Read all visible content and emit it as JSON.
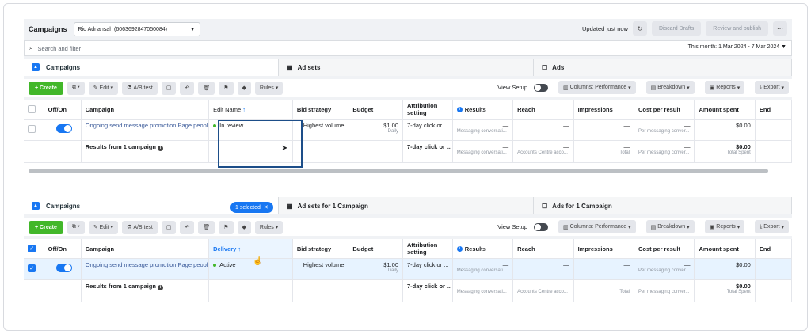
{
  "panel1": {
    "title": "Campaigns",
    "account": "Rio Adriansah (6063692847050084)",
    "updated": "Updated just now",
    "discard": "Discard Drafts",
    "review": "Review and publish",
    "search_placeholder": "Search and filter",
    "date_range": "This month: 1 Mar 2024 - 7 Mar 2024",
    "tabs": {
      "campaigns": "Campaigns",
      "adsets": "Ad sets",
      "ads": "Ads"
    },
    "toolbar": {
      "create": "Create",
      "edit": "Edit",
      "abtest": "A/B test",
      "rules": "Rules",
      "view_setup": "View Setup",
      "columns": "Columns: Performance",
      "breakdown": "Breakdown",
      "reports": "Reports",
      "export": "Export"
    },
    "headers": {
      "offon": "Off/On",
      "campaign": "Campaign",
      "delivery": "Edit Name",
      "bid": "Bid strategy",
      "budget": "Budget",
      "attribution": "Attribution setting",
      "results": "Results",
      "reach": "Reach",
      "impressions": "Impressions",
      "cpr": "Cost per result",
      "spent": "Amount spent",
      "end": "End"
    },
    "row": {
      "campaign": "Ongoing send message promotion Page people",
      "delivery": "In review",
      "bid": "Highest volume",
      "budget": "$1.00",
      "budget_sub": "Daily",
      "attribution": "7-day click or ...",
      "results": "—",
      "results_sub": "Messaging conversati...",
      "reach": "—",
      "impressions": "—",
      "cpr": "—",
      "cpr_sub": "Per messaging conver...",
      "spent": "$0.00"
    },
    "summary": {
      "label": "Results from 1 campaign",
      "attribution": "7-day click or ...",
      "results": "—",
      "results_sub": "Messaging conversati...",
      "reach": "—",
      "reach_sub": "Accounts Centre acco...",
      "impressions": "—",
      "impressions_sub": "Total",
      "cpr": "—",
      "cpr_sub": "Per messaging conver...",
      "spent": "$0.00",
      "spent_sub": "Total Spent"
    }
  },
  "panel2": {
    "tabs": {
      "campaigns": "Campaigns",
      "selected": "1 selected",
      "adsets": "Ad sets for 1 Campaign",
      "ads": "Ads for 1 Campaign"
    },
    "toolbar": {
      "create": "Create",
      "edit": "Edit",
      "abtest": "A/B test",
      "rules": "Rules",
      "view_setup": "View Setup",
      "columns": "Columns: Performance",
      "breakdown": "Breakdown",
      "reports": "Reports",
      "export": "Export"
    },
    "headers": {
      "offon": "Off/On",
      "campaign": "Campaign",
      "delivery": "Delivery",
      "bid": "Bid strategy",
      "budget": "Budget",
      "attribution": "Attribution setting",
      "results": "Results",
      "reach": "Reach",
      "impressions": "Impressions",
      "cpr": "Cost per result",
      "spent": "Amount spent",
      "end": "End"
    },
    "row": {
      "campaign": "Ongoing send message promotion Page people",
      "delivery": "Active",
      "bid": "Highest volume",
      "budget": "$1.00",
      "budget_sub": "Daily",
      "attribution": "7-day click or ...",
      "results": "—",
      "results_sub": "Messaging conversati...",
      "reach": "—",
      "impressions": "—",
      "cpr": "—",
      "cpr_sub": "Per messaging conver...",
      "spent": "$0.00"
    },
    "summary": {
      "label": "Results from 1 campaign",
      "attribution": "7-day click or ...",
      "results": "—",
      "results_sub": "Messaging conversati...",
      "reach": "—",
      "reach_sub": "Accounts Centre acco...",
      "impressions": "—",
      "impressions_sub": "Total",
      "cpr": "—",
      "cpr_sub": "Per messaging conver...",
      "spent": "$0.00",
      "spent_sub": "Total Spent"
    }
  }
}
